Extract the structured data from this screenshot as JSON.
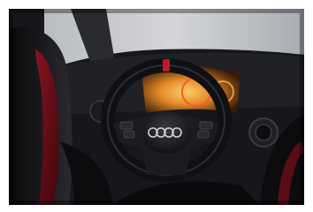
{
  "image": {
    "kind": "photograph",
    "palette": {
      "dark": "#0d0e11",
      "leather": "#1b1c20",
      "red_stitch": "#c01a28",
      "seat_red": "#6e0f19",
      "cockpit_amber": "#f2a23a",
      "window": "#c9ccd0"
    },
    "icons": [
      "four-rings-logo"
    ]
  }
}
